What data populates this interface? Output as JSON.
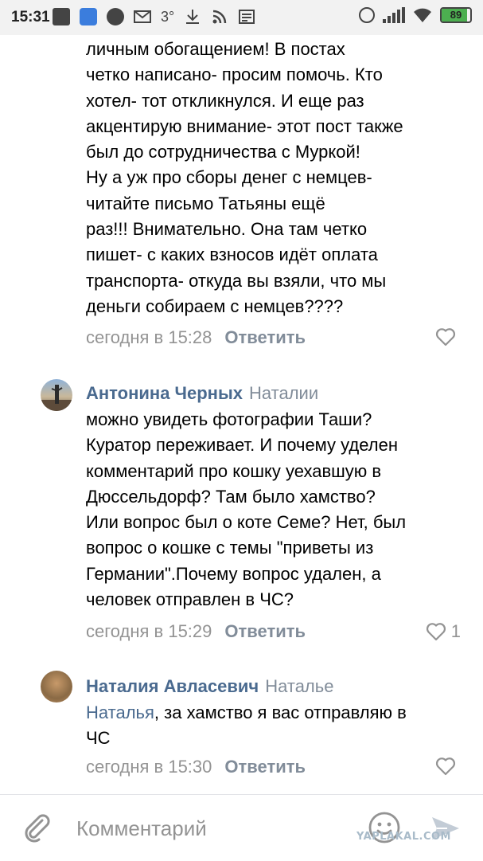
{
  "status_bar": {
    "time": "15:31",
    "temp": "3°",
    "battery_level": "89",
    "battery_fraction": 0.89
  },
  "comments": [
    {
      "continued": true,
      "lines": [
        "личным обогащением! В постах",
        "четко написано- просим помочь. Кто",
        "хотел- тот откликнулся. И еще раз",
        "акцентирую внимание- этот пост также",
        "был до сотрудничества с Муркой!",
        "Ну а уж про сборы денег с немцев-",
        "читайте письмо Татьяны ещё",
        "раз!!! Внимательно. Она там четко",
        "пишет- с каких взносов идёт оплата",
        "транспорта- откуда вы взяли, что мы",
        "деньги собираем с немцев????"
      ],
      "timestamp": "сегодня в 15:28",
      "reply_label": "Ответить",
      "likes": ""
    },
    {
      "author": "Антонина Черных",
      "reply_to": "Наталии",
      "lines": [
        "можно увидеть фотографии Таши?",
        "Куратор переживает. И почему уделен",
        "комментарий про кошку уехавшую в",
        "Дюссельдорф? Там было хамство?",
        "Или вопрос был о коте Семе? Нет, был",
        "вопрос о кошке с темы \"приветы из",
        "Германии\".Почему вопрос удален, а",
        "человек отправлен в ЧС?"
      ],
      "timestamp": "сегодня в 15:29",
      "reply_label": "Ответить",
      "likes": "1"
    },
    {
      "author": "Наталия Авласевич",
      "reply_to": "Наталье",
      "mention": "Наталья",
      "line1_rest": ", за хамство я вас отправляю в",
      "line2": "ЧС",
      "timestamp": "сегодня в 15:30",
      "reply_label": "Ответить",
      "likes": ""
    }
  ],
  "composer": {
    "placeholder": "Комментарий"
  },
  "watermark": "YAPLAKAL.COM",
  "icons": {
    "attach": "paperclip-icon",
    "emoji": "emoji-icon",
    "send": "send-icon",
    "like": "heart-icon"
  }
}
